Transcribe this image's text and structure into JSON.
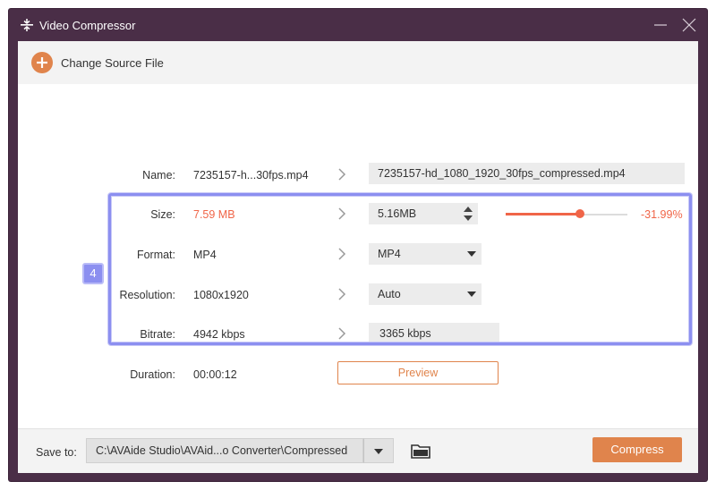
{
  "window": {
    "title": "Video Compressor"
  },
  "toolbar": {
    "change_source_label": "Change Source File"
  },
  "form": {
    "name": {
      "label": "Name:",
      "source": "7235157-h...30fps.mp4",
      "output": "7235157-hd_1080_1920_30fps_compressed.mp4"
    },
    "size": {
      "label": "Size:",
      "source": "7.59 MB",
      "output": "5.16MB",
      "percent": "-31.99%",
      "slider_level": 0.61
    },
    "format": {
      "label": "Format:",
      "source": "MP4",
      "output": "MP4"
    },
    "resolution": {
      "label": "Resolution:",
      "source": "1080x1920",
      "output": "Auto"
    },
    "bitrate": {
      "label": "Bitrate:",
      "source": "4942 kbps",
      "output": "3365 kbps"
    },
    "duration": {
      "label": "Duration:",
      "source": "00:00:12"
    }
  },
  "preview_label": "Preview",
  "step_badge": "4",
  "footer": {
    "save_label": "Save to:",
    "path": "C:\\AVAide Studio\\AVAid...o Converter\\Compressed",
    "compress_label": "Compress"
  },
  "colors": {
    "accent": "#e0844c",
    "slider": "#f06548",
    "highlight": "#8c8ff0",
    "titlebar": "#4a2e47"
  },
  "icons": [
    "compress-app-icon",
    "minimize-icon",
    "close-icon",
    "plus-icon",
    "chevron-right-icon",
    "caret-down-icon",
    "spin-up-icon",
    "spin-down-icon",
    "folder-icon"
  ]
}
